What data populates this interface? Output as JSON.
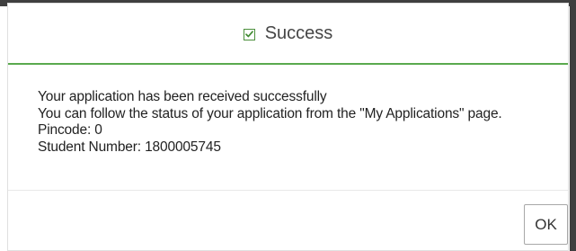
{
  "dialog": {
    "title": "Success",
    "title_icon": "checkbox-checked-icon",
    "accent_color": "#5aaa4e",
    "body": {
      "line1": "Your application has been received successfully",
      "line2": "You can follow the status of your application from the \"My Applications\" page.",
      "pincode": "Pincode: 0",
      "student_number": "Student Number: 1800005745"
    },
    "ok_label": "OK"
  }
}
